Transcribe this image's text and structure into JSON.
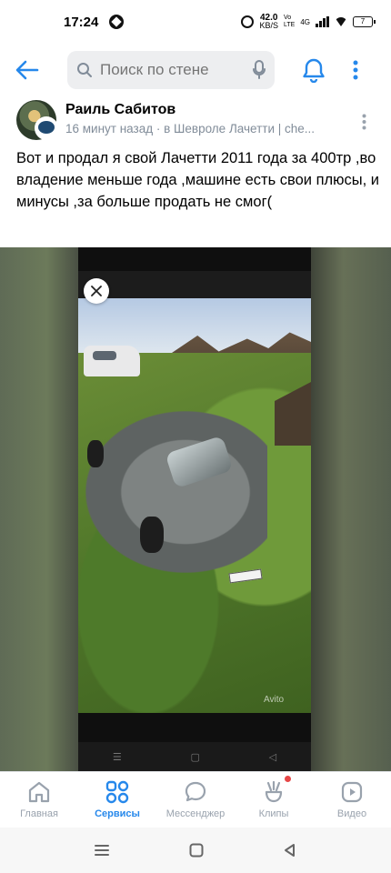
{
  "status_bar": {
    "time": "17:24",
    "network_speed": "42.0",
    "network_speed_unit": "KB/S",
    "vo_top": "Vo",
    "vo_bottom": "LTE",
    "signal_type": "4G",
    "battery": "7"
  },
  "header": {
    "search_placeholder": "Поиск по стене",
    "icons": [
      "back-arrow-icon",
      "search-icon",
      "microphone-icon",
      "bell-icon",
      "more-vertical-icon"
    ],
    "accent_color": "#2688eb"
  },
  "post": {
    "author": "Раиль Сабитов",
    "meta": "16 минут назад · в Шевроле Лачетти | che...",
    "text": "Вот и продал я свой Лачетти 2011 года за 400тр ,во владение меньше года ,машине есть свои плюсы, и минусы ,за больше продать не смог(",
    "photo_watermark": "Avito"
  },
  "tabs": [
    {
      "label": "Главная",
      "icon": "home-icon",
      "active": false
    },
    {
      "label": "Сервисы",
      "icon": "services-grid-icon",
      "active": true
    },
    {
      "label": "Мессенджер",
      "icon": "messenger-icon",
      "active": false
    },
    {
      "label": "Клипы",
      "icon": "clips-icon",
      "active": false
    },
    {
      "label": "Видео",
      "icon": "video-icon",
      "active": false
    }
  ],
  "system_nav": [
    "menu-icon",
    "home-square-icon",
    "back-triangle-icon"
  ]
}
